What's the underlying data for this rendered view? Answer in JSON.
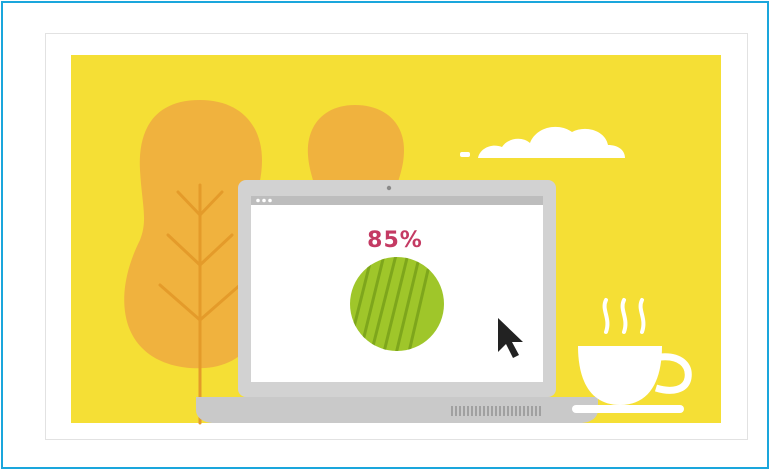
{
  "progress": {
    "label": "85%",
    "value_percent": 85
  },
  "colors": {
    "frame_border": "#1aa6dc",
    "background_yellow": "#f5df35",
    "tree_orange": "#f0b23e",
    "tree_trunk": "#e49b2a",
    "laptop_body": "#c9c9c9",
    "laptop_screen": "#ffffff",
    "percent_text": "#c43a63",
    "progress_circle": "#9fc62a",
    "cursor": "#222222"
  },
  "icons": {
    "cursor": "mouse-pointer-icon",
    "coffee": "coffee-cup-icon",
    "cloud": "cloud-icon",
    "camera": "webcam-icon"
  }
}
